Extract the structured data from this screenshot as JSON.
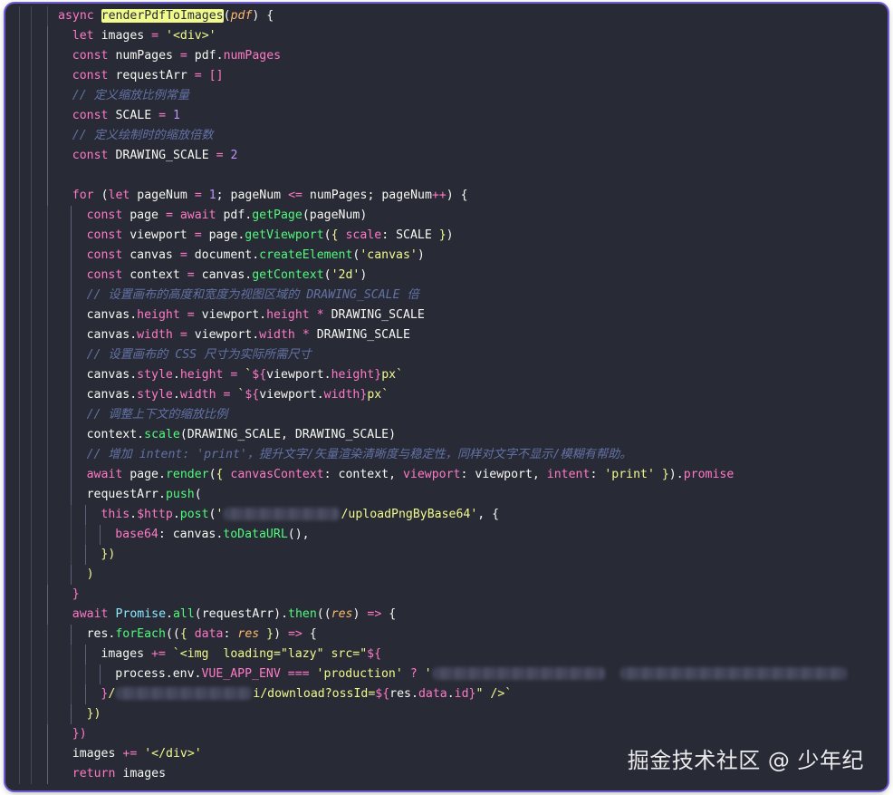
{
  "editor": {
    "lines": [
      {
        "indent": 0,
        "tokens": [
          [
            "kw",
            "async "
          ],
          [
            "fn hl",
            "renderPdfToImages"
          ],
          [
            "punct",
            "("
          ],
          [
            "param",
            "pdf"
          ],
          [
            "punct",
            ") {"
          ]
        ]
      },
      {
        "indent": 1,
        "tokens": [
          [
            "kw",
            "let "
          ],
          [
            "var",
            "images "
          ],
          [
            "op",
            "= "
          ],
          [
            "str",
            "'<div>'"
          ]
        ]
      },
      {
        "indent": 1,
        "tokens": [
          [
            "kw",
            "const "
          ],
          [
            "var",
            "numPages "
          ],
          [
            "op",
            "= "
          ],
          [
            "var",
            "pdf."
          ],
          [
            "prop",
            "numPages"
          ]
        ]
      },
      {
        "indent": 1,
        "tokens": [
          [
            "kw",
            "const "
          ],
          [
            "var",
            "requestArr "
          ],
          [
            "op",
            "= "
          ],
          [
            "kw",
            "[]"
          ]
        ]
      },
      {
        "indent": 1,
        "tokens": [
          [
            "cmt",
            "// 定义缩放比例常量"
          ]
        ]
      },
      {
        "indent": 1,
        "tokens": [
          [
            "kw",
            "const "
          ],
          [
            "var",
            "SCALE "
          ],
          [
            "op",
            "= "
          ],
          [
            "num",
            "1"
          ]
        ]
      },
      {
        "indent": 1,
        "tokens": [
          [
            "cmt",
            "// 定义绘制时的缩放倍数"
          ]
        ]
      },
      {
        "indent": 1,
        "tokens": [
          [
            "kw",
            "const "
          ],
          [
            "var",
            "DRAWING_SCALE "
          ],
          [
            "op",
            "= "
          ],
          [
            "num",
            "2"
          ]
        ]
      },
      {
        "indent": 1,
        "tokens": []
      },
      {
        "indent": 1,
        "tokens": [
          [
            "kw",
            "for "
          ],
          [
            "punct",
            "("
          ],
          [
            "kw",
            "let "
          ],
          [
            "var",
            "pageNum "
          ],
          [
            "op",
            "= "
          ],
          [
            "num",
            "1"
          ],
          [
            "punct",
            "; "
          ],
          [
            "var",
            "pageNum "
          ],
          [
            "op",
            "<= "
          ],
          [
            "var",
            "numPages"
          ],
          [
            "punct",
            "; "
          ],
          [
            "var",
            "pageNum"
          ],
          [
            "op",
            "++"
          ],
          [
            "punct",
            ") {"
          ]
        ]
      },
      {
        "indent": 2,
        "tokens": [
          [
            "kw",
            "const "
          ],
          [
            "var",
            "page "
          ],
          [
            "op",
            "= "
          ],
          [
            "kw",
            "await "
          ],
          [
            "var",
            "pdf."
          ],
          [
            "fn",
            "getPage"
          ],
          [
            "punct",
            "(pageNum)"
          ]
        ]
      },
      {
        "indent": 2,
        "tokens": [
          [
            "kw",
            "const "
          ],
          [
            "var",
            "viewport "
          ],
          [
            "op",
            "= "
          ],
          [
            "var",
            "page."
          ],
          [
            "fn",
            "getViewport"
          ],
          [
            "punct",
            "("
          ],
          [
            "bracket",
            "{ "
          ],
          [
            "prop",
            "scale"
          ],
          [
            "punct",
            ": SCALE "
          ],
          [
            "bracket",
            "}"
          ],
          [
            "punct",
            ")"
          ]
        ]
      },
      {
        "indent": 2,
        "tokens": [
          [
            "kw",
            "const "
          ],
          [
            "var",
            "canvas "
          ],
          [
            "op",
            "= "
          ],
          [
            "var",
            "document."
          ],
          [
            "fn",
            "createElement"
          ],
          [
            "punct",
            "("
          ],
          [
            "str",
            "'canvas'"
          ],
          [
            "punct",
            ")"
          ]
        ]
      },
      {
        "indent": 2,
        "tokens": [
          [
            "kw",
            "const "
          ],
          [
            "var",
            "context "
          ],
          [
            "op",
            "= "
          ],
          [
            "var",
            "canvas."
          ],
          [
            "fn",
            "getContext"
          ],
          [
            "punct",
            "("
          ],
          [
            "str",
            "'2d'"
          ],
          [
            "punct",
            ")"
          ]
        ]
      },
      {
        "indent": 2,
        "tokens": [
          [
            "cmt",
            "// 设置画布的高度和宽度为视图区域的 DRAWING_SCALE 倍"
          ]
        ]
      },
      {
        "indent": 2,
        "tokens": [
          [
            "var",
            "canvas."
          ],
          [
            "prop",
            "height "
          ],
          [
            "op",
            "= "
          ],
          [
            "var",
            "viewport."
          ],
          [
            "prop",
            "height "
          ],
          [
            "op",
            "* "
          ],
          [
            "var",
            "DRAWING_SCALE"
          ]
        ]
      },
      {
        "indent": 2,
        "tokens": [
          [
            "var",
            "canvas."
          ],
          [
            "prop",
            "width "
          ],
          [
            "op",
            "= "
          ],
          [
            "var",
            "viewport."
          ],
          [
            "prop",
            "width "
          ],
          [
            "op",
            "* "
          ],
          [
            "var",
            "DRAWING_SCALE"
          ]
        ]
      },
      {
        "indent": 2,
        "tokens": [
          [
            "cmt",
            "// 设置画布的 CSS 尺寸为实际所需尺寸"
          ]
        ]
      },
      {
        "indent": 2,
        "tokens": [
          [
            "var",
            "canvas."
          ],
          [
            "prop",
            "style"
          ],
          [
            "var",
            "."
          ],
          [
            "prop",
            "height "
          ],
          [
            "op",
            "= "
          ],
          [
            "str",
            "`"
          ],
          [
            "kw",
            "${"
          ],
          [
            "var",
            "viewport."
          ],
          [
            "prop",
            "height"
          ],
          [
            "kw",
            "}"
          ],
          [
            "str",
            "px`"
          ]
        ]
      },
      {
        "indent": 2,
        "tokens": [
          [
            "var",
            "canvas."
          ],
          [
            "prop",
            "style"
          ],
          [
            "var",
            "."
          ],
          [
            "prop",
            "width "
          ],
          [
            "op",
            "= "
          ],
          [
            "str",
            "`"
          ],
          [
            "kw",
            "${"
          ],
          [
            "var",
            "viewport."
          ],
          [
            "prop",
            "width"
          ],
          [
            "kw",
            "}"
          ],
          [
            "str",
            "px`"
          ]
        ]
      },
      {
        "indent": 2,
        "tokens": [
          [
            "cmt",
            "// 调整上下文的缩放比例"
          ]
        ]
      },
      {
        "indent": 2,
        "tokens": [
          [
            "var",
            "context."
          ],
          [
            "fn",
            "scale"
          ],
          [
            "punct",
            "(DRAWING_SCALE, DRAWING_SCALE)"
          ]
        ]
      },
      {
        "indent": 2,
        "tokens": [
          [
            "cmt",
            "// 增加 intent: 'print'，提升文字/矢量渲染清晰度与稳定性，同样对文字不显示/模糊有帮助。"
          ]
        ]
      },
      {
        "indent": 2,
        "tokens": [
          [
            "kw",
            "await "
          ],
          [
            "var",
            "page."
          ],
          [
            "fn",
            "render"
          ],
          [
            "punct",
            "("
          ],
          [
            "bracket",
            "{ "
          ],
          [
            "prop",
            "canvasContext"
          ],
          [
            "punct",
            ": context, "
          ],
          [
            "prop",
            "viewport"
          ],
          [
            "punct",
            ": viewport, "
          ],
          [
            "prop",
            "intent"
          ],
          [
            "punct",
            ": "
          ],
          [
            "str",
            "'print'"
          ],
          [
            "bracket",
            " }"
          ],
          [
            "punct",
            ")."
          ],
          [
            "prop",
            "promise"
          ]
        ]
      },
      {
        "indent": 2,
        "tokens": [
          [
            "var",
            "requestArr."
          ],
          [
            "fn",
            "push"
          ],
          [
            "punct",
            "("
          ]
        ]
      },
      {
        "indent": 3,
        "tokens": [
          [
            "kw",
            "this"
          ],
          [
            "var",
            "."
          ],
          [
            "prop",
            "$http"
          ],
          [
            "var",
            "."
          ],
          [
            "fn",
            "post"
          ],
          [
            "punct",
            "("
          ],
          [
            "str",
            "'"
          ],
          [
            "blur",
            "128"
          ],
          [
            "str",
            "/uploadPngByBase64'"
          ],
          [
            "punct",
            ", {"
          ]
        ]
      },
      {
        "indent": 4,
        "tokens": [
          [
            "prop",
            "base64"
          ],
          [
            "punct",
            ": canvas."
          ],
          [
            "fn",
            "toDataURL"
          ],
          [
            "punct",
            "(),"
          ]
        ]
      },
      {
        "indent": 3,
        "tokens": [
          [
            "bracket",
            "})"
          ]
        ]
      },
      {
        "indent": 2,
        "tokens": [
          [
            "bracket",
            ")"
          ]
        ]
      },
      {
        "indent": 1,
        "tokens": [
          [
            "kw",
            "}"
          ]
        ]
      },
      {
        "indent": 1,
        "tokens": [
          [
            "kw",
            "await "
          ],
          [
            "cls",
            "Promise"
          ],
          [
            "var",
            "."
          ],
          [
            "fn",
            "all"
          ],
          [
            "punct",
            "(requestArr)."
          ],
          [
            "fn",
            "then"
          ],
          [
            "punct",
            "(("
          ],
          [
            "param",
            "res"
          ],
          [
            "punct",
            ") "
          ],
          [
            "kw",
            "=> "
          ],
          [
            "punct",
            "{"
          ]
        ]
      },
      {
        "indent": 2,
        "tokens": [
          [
            "var",
            "res."
          ],
          [
            "fn",
            "forEach"
          ],
          [
            "punct",
            "(("
          ],
          [
            "bracket",
            "{ "
          ],
          [
            "prop",
            "data"
          ],
          [
            "punct",
            ": "
          ],
          [
            "param",
            "res "
          ],
          [
            "bracket",
            "}"
          ],
          [
            "punct",
            ") "
          ],
          [
            "kw",
            "=> "
          ],
          [
            "punct",
            "{"
          ]
        ]
      },
      {
        "indent": 3,
        "tokens": [
          [
            "var",
            "images "
          ],
          [
            "op",
            "+= "
          ],
          [
            "str",
            "`<img  loading=\"lazy\" src=\""
          ],
          [
            "kw",
            "${"
          ]
        ]
      },
      {
        "indent": 4,
        "tokens": [
          [
            "var",
            "process.env."
          ],
          [
            "prop",
            "VUE_APP_ENV "
          ],
          [
            "op",
            "=== "
          ],
          [
            "str",
            "'production' "
          ],
          [
            "op",
            "? "
          ],
          [
            "str",
            "'"
          ],
          [
            "blur",
            "190"
          ],
          [
            "punct",
            "  "
          ],
          [
            "blur",
            "250"
          ]
        ]
      },
      {
        "indent": 3,
        "tokens": [
          [
            "kw",
            "}"
          ],
          [
            "str",
            "/"
          ],
          [
            "blur",
            "150"
          ],
          [
            "str",
            "i/download?ossId="
          ],
          [
            "kw",
            "${"
          ],
          [
            "var",
            "res."
          ],
          [
            "prop",
            "data"
          ],
          [
            "var",
            "."
          ],
          [
            "prop",
            "id"
          ],
          [
            "kw",
            "}"
          ],
          [
            "str",
            "\" />`"
          ]
        ]
      },
      {
        "indent": 2,
        "tokens": [
          [
            "bracket",
            "})"
          ]
        ]
      },
      {
        "indent": 1,
        "tokens": [
          [
            "kw",
            "})"
          ]
        ]
      },
      {
        "indent": 1,
        "tokens": [
          [
            "var",
            "images "
          ],
          [
            "op",
            "+= "
          ],
          [
            "str",
            "'</div>'"
          ]
        ]
      },
      {
        "indent": 1,
        "tokens": [
          [
            "kw",
            "return "
          ],
          [
            "var",
            "images"
          ]
        ]
      }
    ]
  },
  "watermark": {
    "text": "掘金技术社区 @ 少年纪"
  }
}
